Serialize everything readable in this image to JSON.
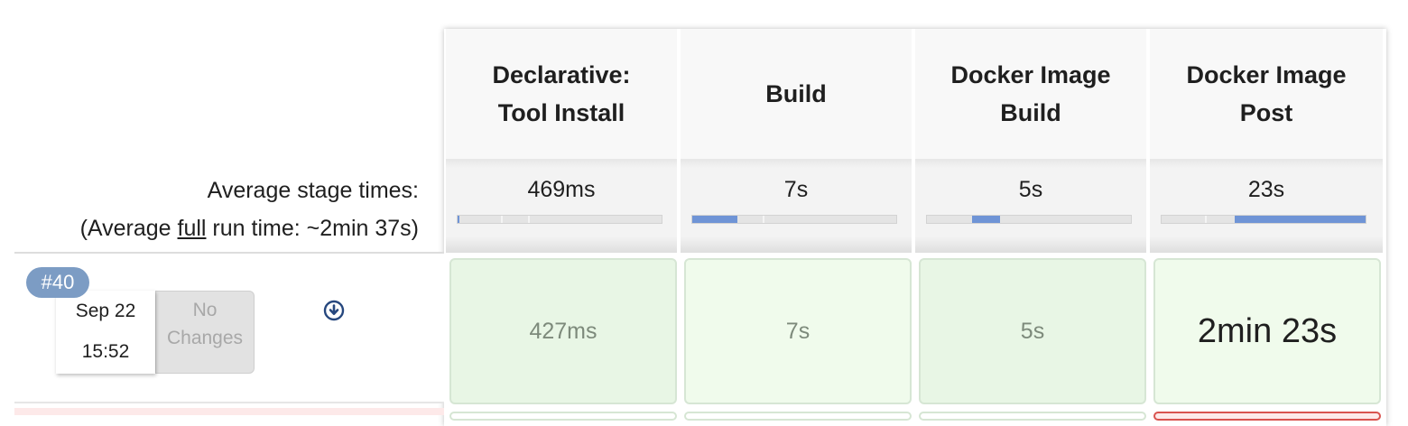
{
  "stages": [
    {
      "name_line1": "Declarative:",
      "name_line2": "Tool Install",
      "avg": "469ms",
      "bar_start": 0.0,
      "bar_fill": 0.01
    },
    {
      "name_line1": "Build",
      "name_line2": "",
      "avg": "7s",
      "bar_start": 0.0,
      "bar_fill": 0.22
    },
    {
      "name_line1": "Docker Image",
      "name_line2": "Build",
      "avg": "5s",
      "bar_start": 0.22,
      "bar_fill": 0.14
    },
    {
      "name_line1": "Docker Image",
      "name_line2": "Post",
      "avg": "23s",
      "bar_start": 0.36,
      "bar_fill": 0.64
    }
  ],
  "average": {
    "label": "Average stage times:",
    "run_prefix": "(Average ",
    "run_full": "full",
    "run_suffix": " run time: ~2min 37s)"
  },
  "build": {
    "number": "#40",
    "date": "Sep 22",
    "time": "15:52",
    "changes_line1": "No",
    "changes_line2": "Changes",
    "cells": [
      "427ms",
      "7s",
      "5s",
      "2min 23s"
    ]
  },
  "colors": {
    "success_bg_a": "#e8f6e5",
    "success_bg_b": "#f0fbec",
    "bar_fill": "#6f94d6",
    "badge": "#7c9cc4",
    "failed_row": "#fde9e9"
  }
}
